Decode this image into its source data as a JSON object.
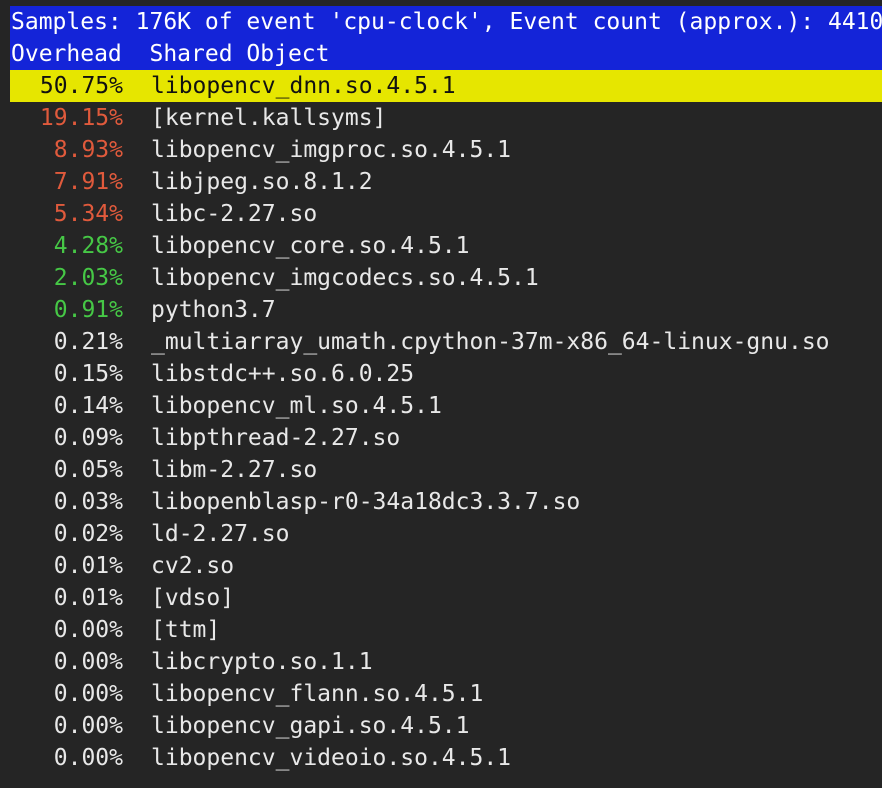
{
  "header": {
    "summary": "Samples: 176K of event 'cpu-clock', Event count (approx.): 4410",
    "col_overhead": "Overhead",
    "col_shared_object": "Shared Object"
  },
  "colors": {
    "header_bg": "#1424d8",
    "selected_bg": "#e6e600",
    "high": "#e05a3c",
    "medium": "#46c846",
    "normal": "#e8e8e8",
    "background": "#252525"
  },
  "rows": [
    {
      "overhead": "50.75%",
      "object": "libopencv_dnn.so.4.5.1",
      "level": "selected"
    },
    {
      "overhead": "19.15%",
      "object": "[kernel.kallsyms]",
      "level": "red"
    },
    {
      "overhead": "8.93%",
      "object": "libopencv_imgproc.so.4.5.1",
      "level": "red"
    },
    {
      "overhead": "7.91%",
      "object": "libjpeg.so.8.1.2",
      "level": "red"
    },
    {
      "overhead": "5.34%",
      "object": "libc-2.27.so",
      "level": "red"
    },
    {
      "overhead": "4.28%",
      "object": "libopencv_core.so.4.5.1",
      "level": "green"
    },
    {
      "overhead": "2.03%",
      "object": "libopencv_imgcodecs.so.4.5.1",
      "level": "green"
    },
    {
      "overhead": "0.91%",
      "object": "python3.7",
      "level": "green"
    },
    {
      "overhead": "0.21%",
      "object": "_multiarray_umath.cpython-37m-x86_64-linux-gnu.so",
      "level": "plain"
    },
    {
      "overhead": "0.15%",
      "object": "libstdc++.so.6.0.25",
      "level": "plain"
    },
    {
      "overhead": "0.14%",
      "object": "libopencv_ml.so.4.5.1",
      "level": "plain"
    },
    {
      "overhead": "0.09%",
      "object": "libpthread-2.27.so",
      "level": "plain"
    },
    {
      "overhead": "0.05%",
      "object": "libm-2.27.so",
      "level": "plain"
    },
    {
      "overhead": "0.03%",
      "object": "libopenblasp-r0-34a18dc3.3.7.so",
      "level": "plain"
    },
    {
      "overhead": "0.02%",
      "object": "ld-2.27.so",
      "level": "plain"
    },
    {
      "overhead": "0.01%",
      "object": "cv2.so",
      "level": "plain"
    },
    {
      "overhead": "0.01%",
      "object": "[vdso]",
      "level": "plain"
    },
    {
      "overhead": "0.00%",
      "object": "[ttm]",
      "level": "plain"
    },
    {
      "overhead": "0.00%",
      "object": "libcrypto.so.1.1",
      "level": "plain"
    },
    {
      "overhead": "0.00%",
      "object": "libopencv_flann.so.4.5.1",
      "level": "plain"
    },
    {
      "overhead": "0.00%",
      "object": "libopencv_gapi.so.4.5.1",
      "level": "plain"
    },
    {
      "overhead": "0.00%",
      "object": "libopencv_videoio.so.4.5.1",
      "level": "plain"
    }
  ]
}
